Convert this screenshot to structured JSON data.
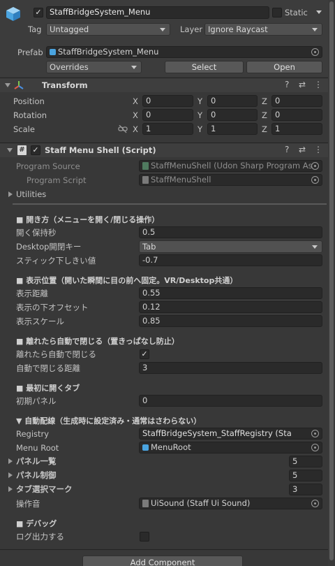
{
  "object": {
    "name": "StaffBridgeSystem_Menu",
    "static_label": "Static",
    "tag_label": "Tag",
    "tag_value": "Untagged",
    "layer_label": "Layer",
    "layer_value": "Ignore Raycast",
    "prefab_label": "Prefab",
    "prefab_value": "StaffBridgeSystem_Menu",
    "overrides_label": "Overrides",
    "select_label": "Select",
    "open_label": "Open",
    "active": true
  },
  "transform": {
    "title": "Transform",
    "rows": [
      {
        "label": "Position",
        "x": "0",
        "y": "0",
        "z": "0"
      },
      {
        "label": "Rotation",
        "x": "0",
        "y": "0",
        "z": "0"
      },
      {
        "label": "Scale",
        "x": "1",
        "y": "1",
        "z": "1"
      }
    ],
    "axis_x": "X",
    "axis_y": "Y",
    "axis_z": "Z"
  },
  "script": {
    "title": "Staff Menu Shell (Script)",
    "program_source_label": "Program Source",
    "program_source_value": "StaffMenuShell (Udon Sharp Program As",
    "program_script_label": "Program Script",
    "program_script_value": "StaffMenuShell",
    "utilities_label": "Utilities"
  },
  "sections": {
    "open": {
      "header": "■ 開き方（メニューを開く/閉じる操作）",
      "hold_label": "開く保持秒",
      "hold_value": "0.5",
      "desktop_key_label": "Desktop開閉キー",
      "desktop_key_value": "Tab",
      "stick_label": "スティック下しきい値",
      "stick_value": "-0.7"
    },
    "position": {
      "header": "■ 表示位置（開いた瞬間に目の前へ固定。VR/Desktop共通）",
      "distance_label": "表示距離",
      "distance_value": "0.55",
      "down_offset_label": "表示の下オフセット",
      "down_offset_value": "0.12",
      "scale_label": "表示スケール",
      "scale_value": "0.85"
    },
    "autoclose": {
      "header": "■ 離れたら自動で閉じる（置きっぱなし防止）",
      "enable_label": "離れたら自動で閉じる",
      "enable_checked": true,
      "distance_label": "自動で閉じる距離",
      "distance_value": "3"
    },
    "first_tab": {
      "header": "■ 最初に開くタブ",
      "panel_label": "初期パネル",
      "panel_value": "0"
    },
    "auto_wiring": {
      "header": "▼ 自動配線（生成時に設定済み・通常はさわらない）",
      "registry_label": "Registry",
      "registry_value": "StaffBridgeSystem_StaffRegistry (Sta",
      "menu_root_label": "Menu Root",
      "menu_root_value": "MenuRoot",
      "panel_list_label": "パネル一覧",
      "panel_list_value": "5",
      "panel_control_label": "パネル制御",
      "panel_control_value": "5",
      "tab_mark_label": "タブ選択マーク",
      "tab_mark_value": "3",
      "sound_label": "操作音",
      "sound_value": "UiSound (Staff Ui Sound)"
    },
    "debug": {
      "header": "■ デバッグ",
      "log_label": "ログ出力する",
      "log_checked": false
    }
  },
  "add_component_label": "Add Component"
}
